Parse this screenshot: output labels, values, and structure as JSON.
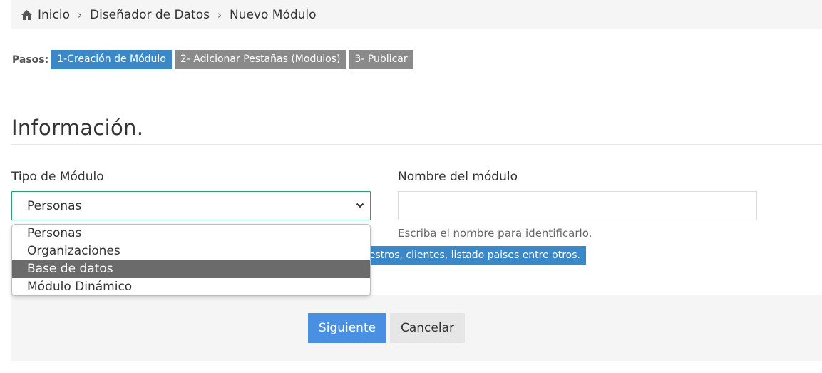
{
  "breadcrumb": {
    "items": [
      "Inicio",
      "Diseñador de Datos",
      "Nuevo Módulo"
    ]
  },
  "steps": {
    "label": "Pasos:",
    "items": [
      {
        "label": "1-Creación de Módulo",
        "state": "active"
      },
      {
        "label": "2- Adicionar Pestañas (Modulos)",
        "state": "inactive"
      },
      {
        "label": "3- Publicar",
        "state": "inactive"
      }
    ]
  },
  "section": {
    "title": "Información."
  },
  "form": {
    "module_type": {
      "label": "Tipo de Módulo",
      "selected": "Personas",
      "options": [
        "Personas",
        "Organizaciones",
        "Base de datos",
        "Módulo Dinámico"
      ],
      "highlighted": "Base de datos"
    },
    "module_name": {
      "label": "Nombre del módulo",
      "value": "",
      "help": "Escriba el nombre para identificarlo."
    },
    "info_banner": "maestros, clientes, listado paises entre otros."
  },
  "actions": {
    "next_label": "Siguiente",
    "cancel_label": "Cancelar"
  },
  "colors": {
    "accent": "#3b88c9",
    "primary_button": "#4a90e2",
    "step_inactive": "#8a8a8a",
    "select_border": "#2aa36b",
    "highlight_option": "#6b6b6b"
  },
  "icons": {
    "home": "home-icon",
    "separator": "chevron-right-icon",
    "select_caret": "chevron-down-icon"
  }
}
